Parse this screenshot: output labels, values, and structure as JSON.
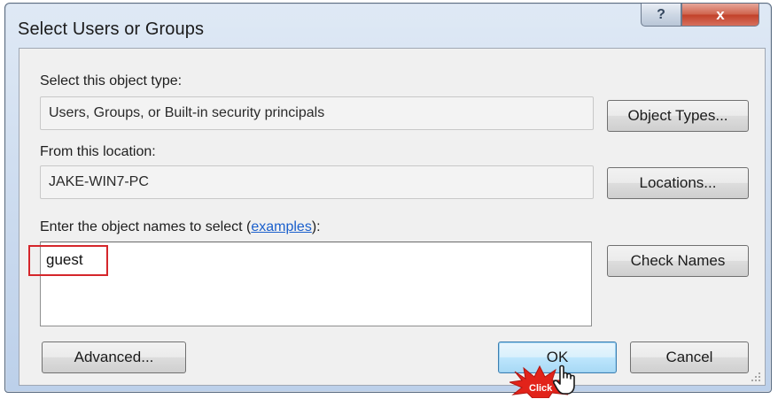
{
  "window": {
    "title": "Select Users or Groups",
    "help_label": "?",
    "close_label": "x"
  },
  "object_type": {
    "label": "Select this object type:",
    "value": "Users, Groups, or Built-in security principals",
    "button": "Object Types..."
  },
  "location": {
    "label": "From this location:",
    "value": "JAKE-WIN7-PC",
    "button": "Locations..."
  },
  "names": {
    "label_prefix": "Enter the object names to select (",
    "label_link": "examples",
    "label_suffix": "):",
    "value": "guest",
    "check_button": "Check Names"
  },
  "footer": {
    "advanced": "Advanced...",
    "ok": "OK",
    "cancel": "Cancel"
  },
  "annotation": {
    "click_label": "Click"
  },
  "colors": {
    "highlight": "#d5262b",
    "link": "#1a5fcc",
    "ok_border": "#3c7fb1",
    "close_button": "#c2412a"
  },
  "icons": [
    "help-icon",
    "close-icon",
    "hand-cursor-icon",
    "resize-grip-icon"
  ]
}
